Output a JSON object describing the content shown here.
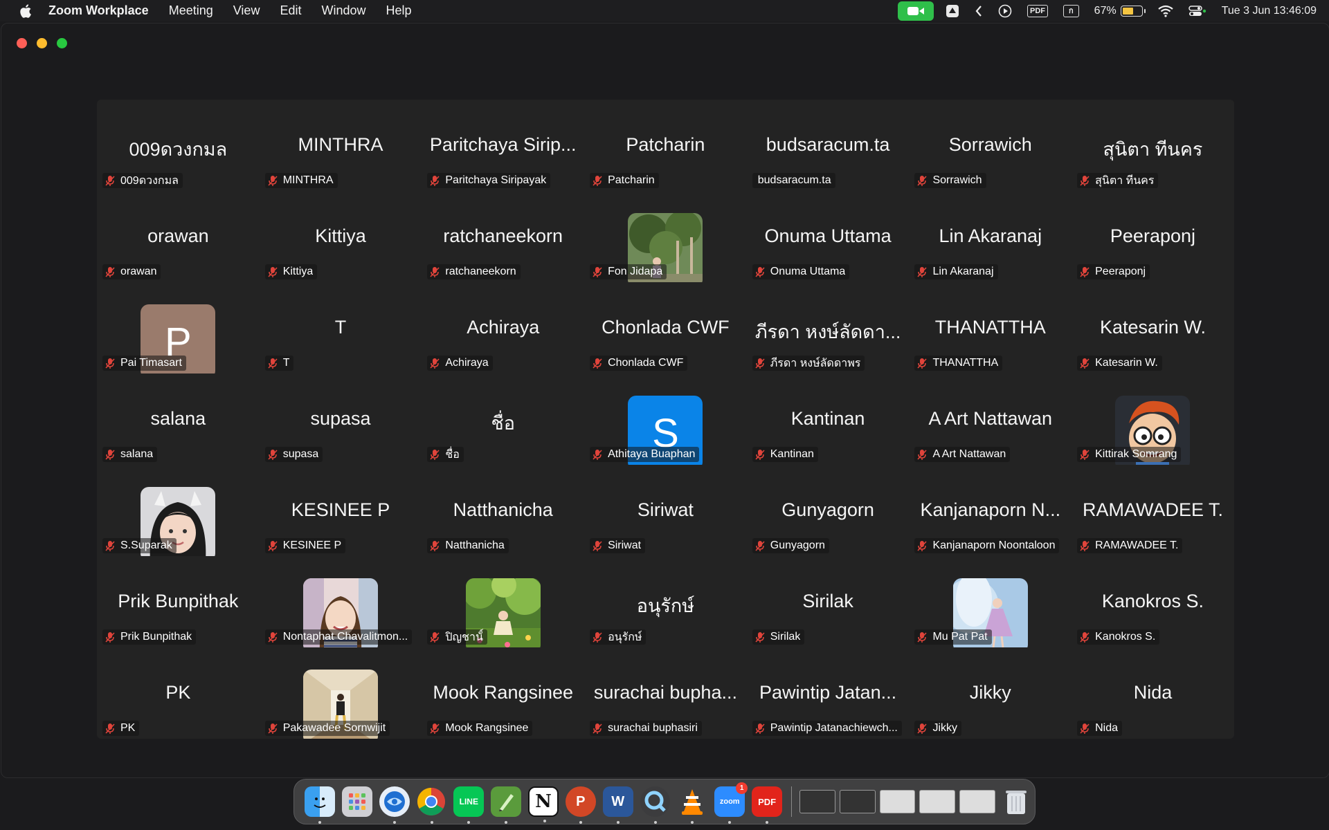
{
  "menubar": {
    "app_name": "Zoom Workplace",
    "menus": [
      "Meeting",
      "View",
      "Edit",
      "Window",
      "Help"
    ],
    "status": {
      "pdf_label": "PDF",
      "keyboard_label": "ก",
      "battery": "67%",
      "battery_level": 0.67,
      "datetime": "Tue 3 Jun  13:46:09"
    }
  },
  "participants": [
    {
      "tile": "009ดวงกมล",
      "label": "009ดวงกมล",
      "muted": true
    },
    {
      "tile": "MINTHRA",
      "label": "MINTHRA",
      "muted": true
    },
    {
      "tile": "Paritchaya Sirip...",
      "label": "Paritchaya Siripayak",
      "muted": true
    },
    {
      "tile": "Patcharin",
      "label": "Patcharin",
      "muted": true
    },
    {
      "tile": "budsaracum.ta",
      "label": "budsaracum.ta",
      "muted": false
    },
    {
      "tile": "Sorrawich",
      "label": "Sorrawich",
      "muted": true
    },
    {
      "tile": "สุนิตา ทีนคร",
      "label": "สุนิตา ทีนคร",
      "muted": true
    },
    {
      "tile": "orawan",
      "label": "orawan",
      "muted": true
    },
    {
      "tile": "Kittiya",
      "label": "Kittiya",
      "muted": true
    },
    {
      "tile": "ratchaneekorn",
      "label": "ratchaneekorn",
      "muted": true
    },
    {
      "tile": "",
      "label": "Fon Jidapa",
      "muted": true,
      "avatar": "photo-trees"
    },
    {
      "tile": "Onuma Uttama",
      "label": "Onuma Uttama",
      "muted": true
    },
    {
      "tile": "Lin Akaranaj",
      "label": "Lin Akaranaj",
      "muted": true
    },
    {
      "tile": "Peeraponj",
      "label": "Peeraponj",
      "muted": true
    },
    {
      "tile": "",
      "label": "Pai Timasart",
      "muted": true,
      "avatar": "letter",
      "letter": "P",
      "color": "#9a7b6c"
    },
    {
      "tile": "T",
      "label": "T",
      "muted": true
    },
    {
      "tile": "Achiraya",
      "label": "Achiraya",
      "muted": true
    },
    {
      "tile": "Chonlada CWF",
      "label": "Chonlada CWF",
      "muted": true
    },
    {
      "tile": "ภีรดา หงษ์ลัดดา...",
      "label": "ภีรดา หงษ์ลัดดาพร",
      "muted": true
    },
    {
      "tile": "THANATTHA",
      "label": "THANATTHA",
      "muted": true
    },
    {
      "tile": "Katesarin W.",
      "label": "Katesarin W.",
      "muted": true
    },
    {
      "tile": "salana",
      "label": "salana",
      "muted": true
    },
    {
      "tile": "supasa",
      "label": "supasa",
      "muted": true
    },
    {
      "tile": "ชื่อ",
      "label": "ชื่อ",
      "muted": true
    },
    {
      "tile": "",
      "label": "Athitaya Buaphan",
      "muted": true,
      "avatar": "letter",
      "letter": "S",
      "color": "#0a84e8"
    },
    {
      "tile": "Kantinan",
      "label": "Kantinan",
      "muted": true
    },
    {
      "tile": "A Art Nattawan",
      "label": "A Art Nattawan",
      "muted": true
    },
    {
      "tile": "",
      "label": "Kittirak Somrang",
      "muted": true,
      "avatar": "photo-cartoon"
    },
    {
      "tile": "",
      "label": "S.Suparak",
      "muted": true,
      "avatar": "photo-selfie"
    },
    {
      "tile": "KESINEE P",
      "label": "KESINEE P",
      "muted": true
    },
    {
      "tile": "Natthanicha",
      "label": "Natthanicha",
      "muted": true
    },
    {
      "tile": "Siriwat",
      "label": "Siriwat",
      "muted": true
    },
    {
      "tile": "Gunyagorn",
      "label": "Gunyagorn",
      "muted": true
    },
    {
      "tile": "Kanjanaporn N...",
      "label": "Kanjanaporn Noontaloon",
      "muted": true
    },
    {
      "tile": "RAMAWADEE T.",
      "label": "RAMAWADEE T.",
      "muted": true
    },
    {
      "tile": "Prik Bunpithak",
      "label": "Prik Bunpithak",
      "muted": true
    },
    {
      "tile": "",
      "label": "Nontaphat Chavalitmon...",
      "muted": true,
      "avatar": "photo-smile"
    },
    {
      "tile": "",
      "label": "ปิญชานั์",
      "muted": true,
      "avatar": "photo-garden"
    },
    {
      "tile": "อนุรักษ์",
      "label": "อนุรักษ์",
      "muted": true
    },
    {
      "tile": "Sirilak",
      "label": "Sirilak",
      "muted": true
    },
    {
      "tile": "",
      "label": "Mu Pat Pat",
      "muted": true,
      "avatar": "photo-sky"
    },
    {
      "tile": "Kanokros S.",
      "label": "Kanokros S.",
      "muted": true
    },
    {
      "tile": "PK",
      "label": "PK",
      "muted": true
    },
    {
      "tile": "",
      "label": "Pakawadee Sornwijit",
      "muted": true,
      "avatar": "photo-hallway"
    },
    {
      "tile": "Mook Rangsinee",
      "label": "Mook Rangsinee",
      "muted": true
    },
    {
      "tile": "surachai bupha...",
      "label": "surachai buphasiri",
      "muted": true
    },
    {
      "tile": "Pawintip Jatan...",
      "label": "Pawintip Jatanachiewch...",
      "muted": true
    },
    {
      "tile": "Jikky",
      "label": "Jikky",
      "muted": true
    },
    {
      "tile": "Nida",
      "label": "Nida",
      "muted": true
    }
  ],
  "dock": {
    "zoom_label": "zoom",
    "zoom_badge": "1",
    "line_label": "LINE",
    "notion_label": "N",
    "pdf_label": "PDF",
    "word_label": "W"
  },
  "colors": {
    "mute": "#e0443b",
    "facetime_green": "#2fbf4a",
    "zoom_blue": "#2d8cff"
  }
}
